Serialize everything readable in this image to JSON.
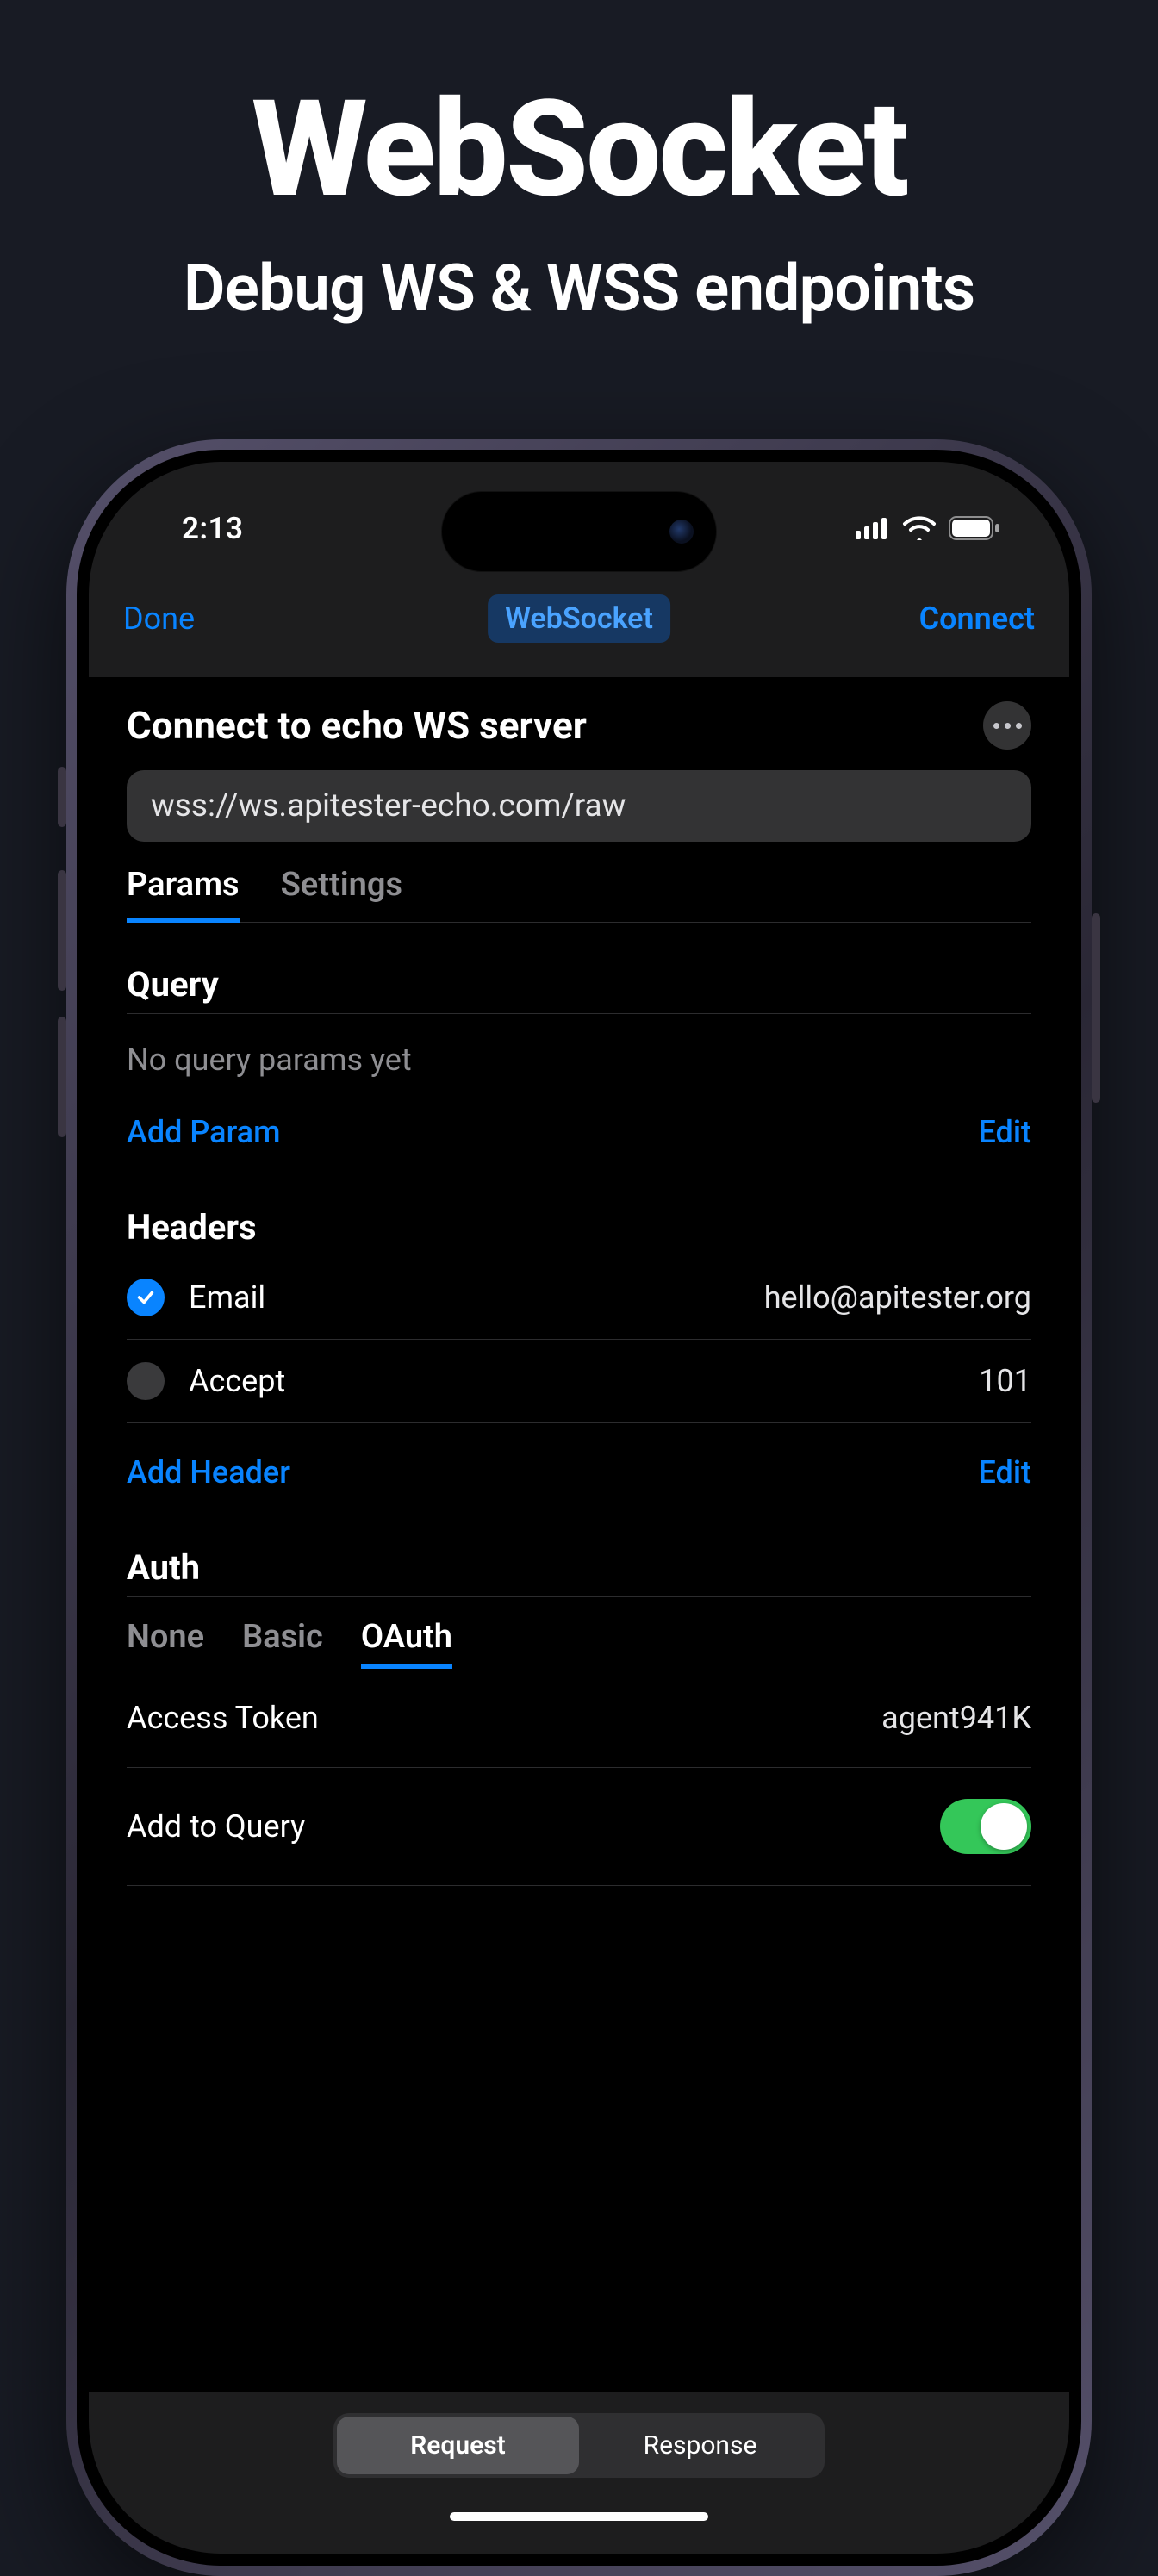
{
  "promo": {
    "title": "WebSocket",
    "subtitle": "Debug WS & WSS endpoints"
  },
  "statusbar": {
    "time": "2:13"
  },
  "nav": {
    "left": "Done",
    "title_chip": "WebSocket",
    "right": "Connect"
  },
  "screen_title": "Connect to echo WS server",
  "url": "wss://ws.apitester-echo.com/raw",
  "top_tabs": {
    "params": "Params",
    "settings": "Settings",
    "active": "params"
  },
  "query": {
    "title": "Query",
    "empty": "No query params yet",
    "add": "Add Param",
    "edit": "Edit"
  },
  "headers": {
    "title": "Headers",
    "add": "Add Header",
    "edit": "Edit",
    "rows": [
      {
        "enabled": true,
        "key": "Email",
        "value": "hello@apitester.org"
      },
      {
        "enabled": false,
        "key": "Accept",
        "value": "101"
      }
    ]
  },
  "auth": {
    "title": "Auth",
    "tabs": {
      "none": "None",
      "basic": "Basic",
      "oauth": "OAuth",
      "active": "oauth"
    },
    "token_label": "Access Token",
    "token_value": "agent941K",
    "add_to_query_label": "Add to Query",
    "add_to_query": true
  },
  "bottom_tabs": {
    "request": "Request",
    "response": "Response",
    "active": "request"
  }
}
